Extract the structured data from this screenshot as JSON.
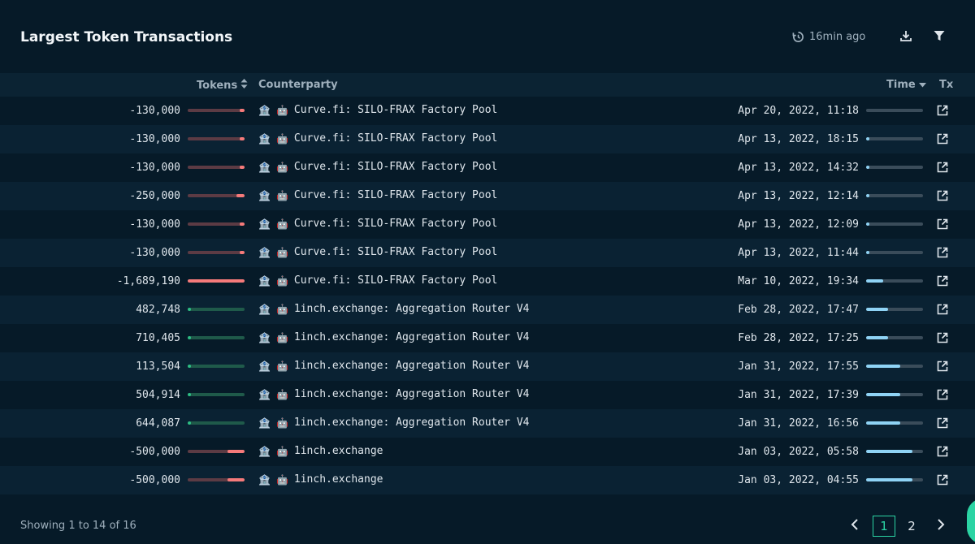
{
  "header": {
    "title": "Largest Token Transactions",
    "updated": "16min ago"
  },
  "table": {
    "columns": {
      "tokens": "Tokens",
      "counterparty": "Counterparty",
      "time": "Time",
      "tx": "Tx"
    },
    "rows": [
      {
        "tokens": "-130,000",
        "token_bar": 0.08,
        "direction": "out",
        "counterparty": "Curve.fi: SILO-FRAX Factory Pool",
        "time": "Apr 20, 2022, 11:18",
        "time_bar": 0.0
      },
      {
        "tokens": "-130,000",
        "token_bar": 0.08,
        "direction": "out",
        "counterparty": "Curve.fi: SILO-FRAX Factory Pool",
        "time": "Apr 13, 2022, 18:15",
        "time_bar": 0.05
      },
      {
        "tokens": "-130,000",
        "token_bar": 0.08,
        "direction": "out",
        "counterparty": "Curve.fi: SILO-FRAX Factory Pool",
        "time": "Apr 13, 2022, 14:32",
        "time_bar": 0.05
      },
      {
        "tokens": "-250,000",
        "token_bar": 0.15,
        "direction": "out",
        "counterparty": "Curve.fi: SILO-FRAX Factory Pool",
        "time": "Apr 13, 2022, 12:14",
        "time_bar": 0.05
      },
      {
        "tokens": "-130,000",
        "token_bar": 0.08,
        "direction": "out",
        "counterparty": "Curve.fi: SILO-FRAX Factory Pool",
        "time": "Apr 13, 2022, 12:09",
        "time_bar": 0.05
      },
      {
        "tokens": "-130,000",
        "token_bar": 0.08,
        "direction": "out",
        "counterparty": "Curve.fi: SILO-FRAX Factory Pool",
        "time": "Apr 13, 2022, 11:44",
        "time_bar": 0.05
      },
      {
        "tokens": "-1,689,190",
        "token_bar": 1.0,
        "direction": "out",
        "counterparty": "Curve.fi: SILO-FRAX Factory Pool",
        "time": "Mar 10, 2022, 19:34",
        "time_bar": 0.3
      },
      {
        "tokens": "482,748",
        "token_bar": 0.03,
        "direction": "in",
        "counterparty": "1inch.exchange: Aggregation Router V4",
        "time": "Feb 28, 2022, 17:47",
        "time_bar": 0.38
      },
      {
        "tokens": "710,405",
        "token_bar": 0.03,
        "direction": "in",
        "counterparty": "1inch.exchange: Aggregation Router V4",
        "time": "Feb 28, 2022, 17:25",
        "time_bar": 0.38
      },
      {
        "tokens": "113,504",
        "token_bar": 0.01,
        "direction": "in",
        "counterparty": "1inch.exchange: Aggregation Router V4",
        "time": "Jan 31, 2022, 17:55",
        "time_bar": 0.6
      },
      {
        "tokens": "504,914",
        "token_bar": 0.02,
        "direction": "in",
        "counterparty": "1inch.exchange: Aggregation Router V4",
        "time": "Jan 31, 2022, 17:39",
        "time_bar": 0.6
      },
      {
        "tokens": "644,087",
        "token_bar": 0.03,
        "direction": "in",
        "counterparty": "1inch.exchange: Aggregation Router V4",
        "time": "Jan 31, 2022, 16:56",
        "time_bar": 0.6
      },
      {
        "tokens": "-500,000",
        "token_bar": 0.3,
        "direction": "out",
        "counterparty": "1inch.exchange",
        "time": "Jan 03, 2022, 05:58",
        "time_bar": 0.82
      },
      {
        "tokens": "-500,000",
        "token_bar": 0.3,
        "direction": "out",
        "counterparty": "1inch.exchange",
        "time": "Jan 03, 2022, 04:55",
        "time_bar": 0.82
      }
    ]
  },
  "footer": {
    "showing": "Showing 1 to 14 of 16",
    "pages": [
      "1",
      "2"
    ],
    "current_page": "1"
  },
  "colors": {
    "background": "#061a28",
    "negative": "#f57a7a",
    "positive": "#2dbd84",
    "time_bar": "#8fd3f5",
    "accent": "#2bd4a4"
  },
  "icons": {
    "header": [
      "history-clock-icon",
      "download-icon",
      "filter-icon"
    ],
    "row": [
      "bank-icon",
      "robot-icon",
      "external-link-icon"
    ],
    "pager": [
      "chevron-left-icon",
      "chevron-right-icon"
    ]
  }
}
